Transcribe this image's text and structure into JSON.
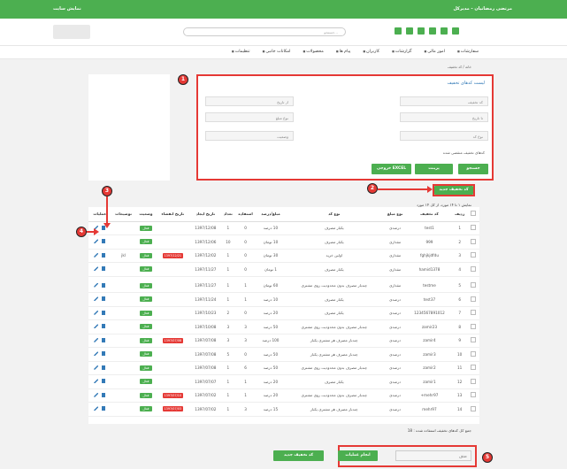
{
  "topbar": {
    "site_link": "نمایش سایت",
    "user_menu": "مرتضی رمضانیان - مدیرکل"
  },
  "header": {
    "search_placeholder": "جستجو..."
  },
  "nav": [
    "سفارشات",
    "امور مالی",
    "گزارشات",
    "کاربران",
    "پیام ها",
    "محصولات",
    "امکانات جانبی",
    "تنظیمات"
  ],
  "breadcrumb": "خانه / کد تخفیف",
  "filter": {
    "title": "لیست کدهای تخفیف",
    "code_placeholder": "کد تخفیف",
    "from_date": "از تاریخ",
    "to_date": "تا تاریخ",
    "amount_type": "نوع مبلغ",
    "code_type": "نوع کد",
    "status": "وضعیت",
    "expired_checkbox": "کدهای تخفیف منقضی شده",
    "search_btn": "جستجو",
    "print_btn": "پرینت",
    "excel_btn": "خروجی EXCEL"
  },
  "new_code_btn": "کد تخفیف جدید",
  "summary": "نمایش ۱ تا ۱۴ مورد، از کل ۱۴ مورد",
  "table": {
    "headers": [
      "ردیف",
      "کد تخفیف",
      "نوع مبلغ",
      "نوع کد",
      "مبلغ/درصد",
      "استفاده",
      "تعداد",
      "تاریخ ایجاد",
      "تاریخ انقضاء",
      "وضعیت",
      "توضیحات",
      "عملیات"
    ],
    "rows": [
      [
        "1",
        "test1",
        "درصدی",
        "یکبار مصرف",
        "10 درصد",
        "0",
        "1",
        "1397/12/08",
        "",
        "فعال",
        ""
      ],
      [
        "2",
        "999",
        "مقداری",
        "یکبار مصرف",
        "10 تومان",
        "0",
        "10",
        "1397/12/06",
        "",
        "فعال",
        ""
      ],
      [
        "3",
        "fghjkjdfdu",
        "مقداری",
        "اولین خرید",
        "30 تومان",
        "0",
        "1",
        "1397/12/02",
        "1397/12/21",
        "فعال",
        "jkl"
      ],
      [
        "4",
        "hamid1378",
        "مقداری",
        "یکبار مصرف",
        "1 تومان",
        "0",
        "1",
        "1397/11/27",
        "",
        "فعال",
        ""
      ],
      [
        "5",
        "testme",
        "مقداری",
        "چندبار مصرف بدون محدودیت روی مشتری",
        "60 تومان",
        "1",
        "1",
        "1397/11/27",
        "",
        "فعال",
        ""
      ],
      [
        "6",
        "test37",
        "درصدی",
        "یکبار مصرف",
        "10 درصد",
        "1",
        "1",
        "1397/11/24",
        "",
        "فعال",
        ""
      ],
      [
        "7",
        "1234567891012",
        "درصدی",
        "یکبار مصرف",
        "20 درصد",
        "0",
        "2",
        "1397/10/23",
        "",
        "فعال",
        ""
      ],
      [
        "8",
        "zamir23",
        "درصدی",
        "چندبار مصرف بدون محدودیت روی مشتری",
        "50 درصد",
        "3",
        "3",
        "1397/10/08",
        "",
        "فعال",
        ""
      ],
      [
        "9",
        "zamir4",
        "درصدی",
        "چندبار مصرف هر مشتری یکبار",
        "100 درصد",
        "3",
        "3",
        "1397/07/08",
        "1397/07/08",
        "فعال",
        ""
      ],
      [
        "10",
        "zamir3",
        "درصدی",
        "چندبار مصرف هر مشتری یکبار",
        "50 درصد",
        "0",
        "5",
        "1397/07/08",
        "",
        "فعال",
        ""
      ],
      [
        "11",
        "zamir2",
        "درصدی",
        "چندبار مصرف بدون محدودیت روی مشتری",
        "50 درصد",
        "6",
        "1",
        "1397/07/08",
        "",
        "فعال",
        ""
      ],
      [
        "12",
        "zamir1",
        "درصدی",
        "یکبار مصرف",
        "20 درصد",
        "1",
        "1",
        "1397/07/07",
        "",
        "فعال",
        ""
      ],
      [
        "13",
        "mehr97+",
        "درصدی",
        "چندبار مصرف بدون محدودیت روی مشتری",
        "20 درصد",
        "1",
        "1",
        "1397/07/02",
        "1397/07/10",
        "فعال",
        ""
      ],
      [
        "14",
        "mehr97",
        "درصدی",
        "چندبار مصرف هر مشتری یکبار",
        "15 درصد",
        "3",
        "1",
        "1397/07/02",
        "1397/07/03",
        "فعال",
        ""
      ]
    ]
  },
  "footer_note": "جمع کل کدهای تخفیف استفاده شده : 18",
  "operation_select": "حذف",
  "do_operation_btn": "انجام عملیات",
  "new_code_btn2": "کد تخفیف جدید",
  "callouts": [
    "1",
    "2",
    "3",
    "4",
    "5"
  ],
  "colors": {
    "primary": "#4caf50",
    "danger": "#e53935",
    "link": "#337ab7"
  }
}
